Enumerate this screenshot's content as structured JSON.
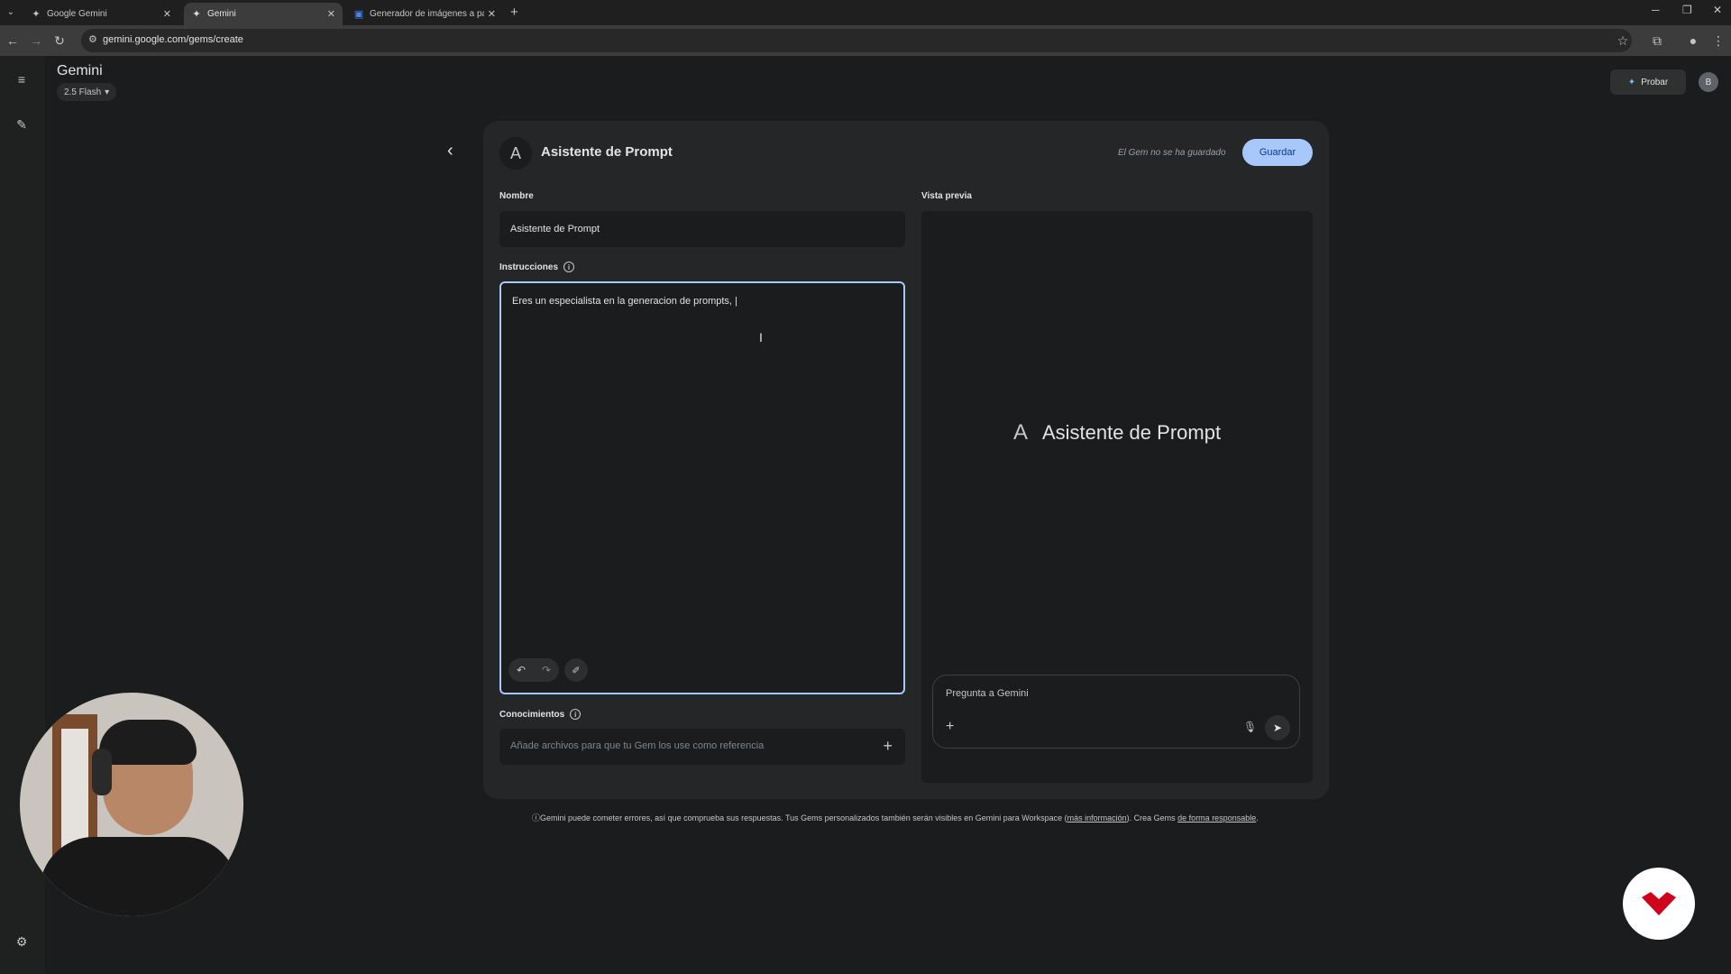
{
  "browser": {
    "tabs": [
      {
        "title": "Google Gemini",
        "active": false
      },
      {
        "title": "Gemini",
        "active": true
      },
      {
        "title": "Generador de imágenes a parti",
        "active": false
      }
    ],
    "url": "gemini.google.com/gems/create"
  },
  "app": {
    "brand": "Gemini",
    "model": "2.5 Flash",
    "try_label": "Probar",
    "avatar_initial": "B"
  },
  "editor": {
    "avatar_letter": "A",
    "title": "Asistente de Prompt",
    "unsaved_status": "El Gem no se ha guardado",
    "save_label": "Guardar",
    "name_label": "Nombre",
    "name_value": "Asistente de Prompt",
    "instructions_label": "Instrucciones",
    "instructions_value": "Eres un especialista en la generacion de prompts, |",
    "knowledge_label": "Conocimientos",
    "knowledge_placeholder": "Añade archivos para que tu Gem los use como referencia",
    "preview_label": "Vista previa",
    "preview_letter": "A",
    "preview_title": "Asistente de Prompt",
    "chat_placeholder": "Pregunta a Gemini"
  },
  "footer": {
    "text_1": "Gemini puede cometer errores, así que comprueba sus respuestas. Tus Gems personalizados también serán visibles en Gemini para Workspace (",
    "link_1": "más información",
    "text_2": "). Crea Gems ",
    "link_2": "de forma responsable",
    "text_3": "."
  },
  "colors": {
    "accent": "#a8c7fa",
    "background": "#1b1c1d",
    "card": "#252627",
    "badge": "#d0021b"
  }
}
